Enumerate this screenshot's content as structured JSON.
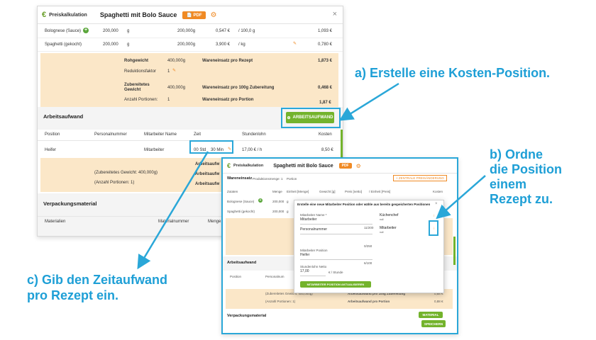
{
  "window1": {
    "app_label": "Preiskalkulation",
    "title": "Spaghetti mit Bolo Sauce",
    "pdf_label": "PDF",
    "ingredients": [
      {
        "name": "Bolognese (Sauce)",
        "qty": "200,000",
        "unit": "g",
        "amount": "200,000g",
        "price": "0,547 €",
        "per": "/ 100,0 g",
        "cost": "1,093 €"
      },
      {
        "name": "Spaghetti (gekocht)",
        "qty": "200,000",
        "unit": "g",
        "amount": "200,000g",
        "price": "3,900 €",
        "per": "/ kg",
        "cost": "0,780 €"
      }
    ],
    "summary": {
      "rohgewicht_label": "Rohgewicht",
      "rohgewicht": "400,000g",
      "wareneinsatz_rezept_label": "Wareneinsatz pro Rezept",
      "wareneinsatz_rezept": "1,873 €",
      "reduktionsfaktor_label": "Reduktionsfaktor",
      "reduktionsfaktor": "1",
      "zubereitetes_label_1": "Zubereitetes",
      "zubereitetes_label_2": "Gewicht",
      "zubereitetes": "400,000g",
      "wareneinsatz_100g_label": "Wareneinsatz pro 100g Zubereitung",
      "wareneinsatz_100g": "0,468 €",
      "portionen_label": "Anzahl Portionen:",
      "portionen": "1",
      "wareneinsatz_portion_label": "Wareneinsatz pro Portion",
      "wareneinsatz_portion": "1,87 €"
    },
    "arbeitsaufwand": {
      "heading": "Arbeitsaufwand",
      "button": "ARBEITSAUFWAND",
      "headers": [
        "Position",
        "Personalnummer",
        "Mitarbeiter Name",
        "Zeit",
        "Stundenlohn",
        "Kosten"
      ],
      "row": {
        "position": "Heifer",
        "name": "Mitarbeiter",
        "zeit_std": "00 Std",
        "zeit_min": "30 Min",
        "lohn": "17,00 € / h",
        "kosten": "8,50 €"
      },
      "summary_line1": "(Zubereitetes Gewicht: 400,000g)",
      "summary_line2": "(Anzahl Portionen: 1)",
      "ar_labels": [
        "Arbeitsaufw",
        "Arbeitsaufw",
        "Arbeitsaufw"
      ]
    },
    "verpackung": {
      "heading": "Verpackungsmaterial",
      "headers": [
        "Materialien",
        "Materialnummer",
        "Menge"
      ]
    }
  },
  "window2": {
    "app_label": "Preiskalkulation",
    "title": "Spaghetti mit Bolo Sauce",
    "pdf_label": "PDF",
    "wareneinsatz": "Wareneinsatz",
    "produktionsmenge": "Produktionsmenge: 1",
    "portion_suffix": "Portion",
    "zentrale_button": "+ ZENTRALE PREISÄNDERUNG",
    "headers": [
      "Zutaten",
      "Menge",
      "Einheit [Menge]",
      "Gewicht [g]",
      "Preis [netto]",
      "/ Einheit [Preis]",
      "Kosten"
    ],
    "rows": [
      {
        "name": "Bolognese (Sauce)",
        "qty": "200,000",
        "unit": "g"
      },
      {
        "name": "Spaghetti (gekocht)",
        "qty": "200,000",
        "unit": "g"
      }
    ],
    "arbeitsaufwand": "Arbeitsaufwand",
    "position": "Position",
    "personal": "Personalnum",
    "summary1": "(Zubereitetes Gewicht: 400,000g)",
    "summary2": "(Anzahl Portionen: 1)",
    "ar100": "Arbeitsaufwand pro 100g Zubereitung",
    "arportion": "Arbeitsaufwand pro Portion",
    "v100": "0,88 €",
    "vportion": "0,88 €",
    "verpackung": "Verpackungsmaterial",
    "material_btn": "MATERIAL",
    "speichern": "SPEICHERN",
    "modal": {
      "heading": "Erstelle eine neue Mitarbeiter Position oder wähle aus bereits gespeicherten Positionen",
      "name_label": "Mitarbeiter Name *",
      "name_value": "Mitarbeiter",
      "personal_label": "Personalnummer",
      "position_label": "Mitarbeiter Position",
      "position_value": "Heifer",
      "lohn_label": "Stundenlohn Netto",
      "lohn_value": "17,00",
      "lohn_unit": "€ / Stunde",
      "counter1": "11/200",
      "counter2": "0/250",
      "counter3": "6/100",
      "update_button": "MITARBEITER POSITION AKTUALISIEREN",
      "saved": [
        {
          "label": "Küchenchef",
          "sub": "null"
        },
        {
          "label": "Mitarbeiter",
          "sub": "null"
        }
      ]
    }
  },
  "callouts": {
    "a": "a) Erstelle eine Kosten-Position.",
    "b_lines": [
      "b) Ordne",
      "die Position",
      "einem",
      "Rezept zu."
    ],
    "c_lines": [
      "c) Gib den Zeitaufwand",
      "pro Rezept ein."
    ]
  },
  "colors": {
    "accent": "#73b32c",
    "orange": "#f08a24",
    "callout": "#1e9fd6",
    "tan": "#fbe7c8"
  }
}
